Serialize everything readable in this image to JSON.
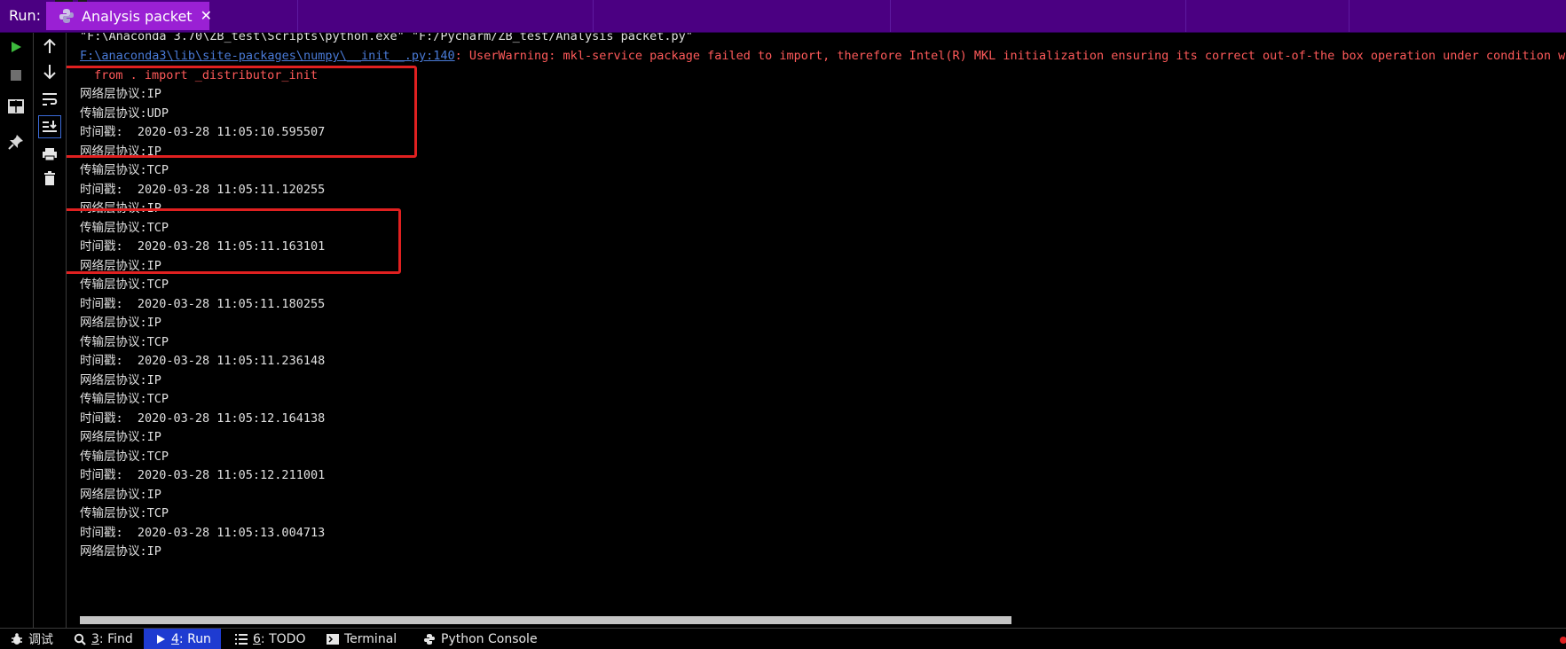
{
  "panel": {
    "run_label": "Run:",
    "tab_title": "Analysis packet",
    "close_glyph": "✕"
  },
  "left_toolbar": [
    {
      "name": "rerun-icon",
      "interactable": true
    },
    {
      "name": "stop-icon",
      "interactable": true
    },
    {
      "name": "layout-icon",
      "interactable": true
    },
    {
      "name": "pin-icon",
      "interactable": true
    }
  ],
  "left_toolbar2": [
    {
      "name": "up-arrow-icon"
    },
    {
      "name": "down-arrow-icon"
    },
    {
      "name": "soft-wrap-icon"
    },
    {
      "name": "scroll-to-end-icon"
    },
    {
      "name": "print-icon"
    },
    {
      "name": "trash-icon"
    }
  ],
  "console": {
    "cmd_line": "\"F:\\Anaconda 3.70\\ZB_test\\Scripts\\python.exe\" \"F:/Pycharm/ZB_test/Analysis packet.py\"",
    "warning_link": "F:\\anaconda3\\lib\\site-packages\\numpy\\__init__.py:140",
    "warning_text": ": UserWarning: mkl-service package failed to import, therefore Intel(R) MKL initialization ensuring its correct out-of-the box operation under condition when",
    "import_line": "from . import _distributor_init",
    "lines": [
      "网络层协议:IP",
      "传输层协议:UDP",
      "时间戳:  2020-03-28 11:05:10.595507",
      "网络层协议:IP",
      "传输层协议:TCP",
      "时间戳:  2020-03-28 11:05:11.120255",
      "网络层协议:IP",
      "传输层协议:TCP",
      "时间戳:  2020-03-28 11:05:11.163101",
      "网络层协议:IP",
      "传输层协议:TCP",
      "时间戳:  2020-03-28 11:05:11.180255",
      "网络层协议:IP",
      "传输层协议:TCP",
      "时间戳:  2020-03-28 11:05:11.236148",
      "网络层协议:IP",
      "传输层协议:TCP",
      "时间戳:  2020-03-28 11:05:12.164138",
      "网络层协议:IP",
      "传输层协议:TCP",
      "时间戳:  2020-03-28 11:05:12.211001",
      "网络层协议:IP",
      "传输层协议:TCP",
      "时间戳:  2020-03-28 11:05:13.004713",
      "网络层协议:IP"
    ]
  },
  "bottom_tabs": [
    {
      "key": "",
      "label": "调试",
      "icon": "bug-icon",
      "active": false
    },
    {
      "key": "3",
      "label": ": Find",
      "icon": "search-icon",
      "active": false
    },
    {
      "key": "4",
      "label": ": Run",
      "icon": "run-icon",
      "active": true
    },
    {
      "key": "6",
      "label": ": TODO",
      "icon": "todo-list-icon",
      "active": false
    },
    {
      "key": "",
      "label": "Terminal",
      "icon": "terminal-icon",
      "active": false
    },
    {
      "key": "",
      "label": "Python Console",
      "icon": "python-icon",
      "active": false
    }
  ],
  "colors": {
    "tab_bar": "#4b0082",
    "active_tab": "#9a20d4",
    "error_text": "#ff5a5a",
    "link": "#4a7bd8",
    "highlight_box": "#e02020",
    "active_bottom_tab": "#1e3bd1"
  }
}
